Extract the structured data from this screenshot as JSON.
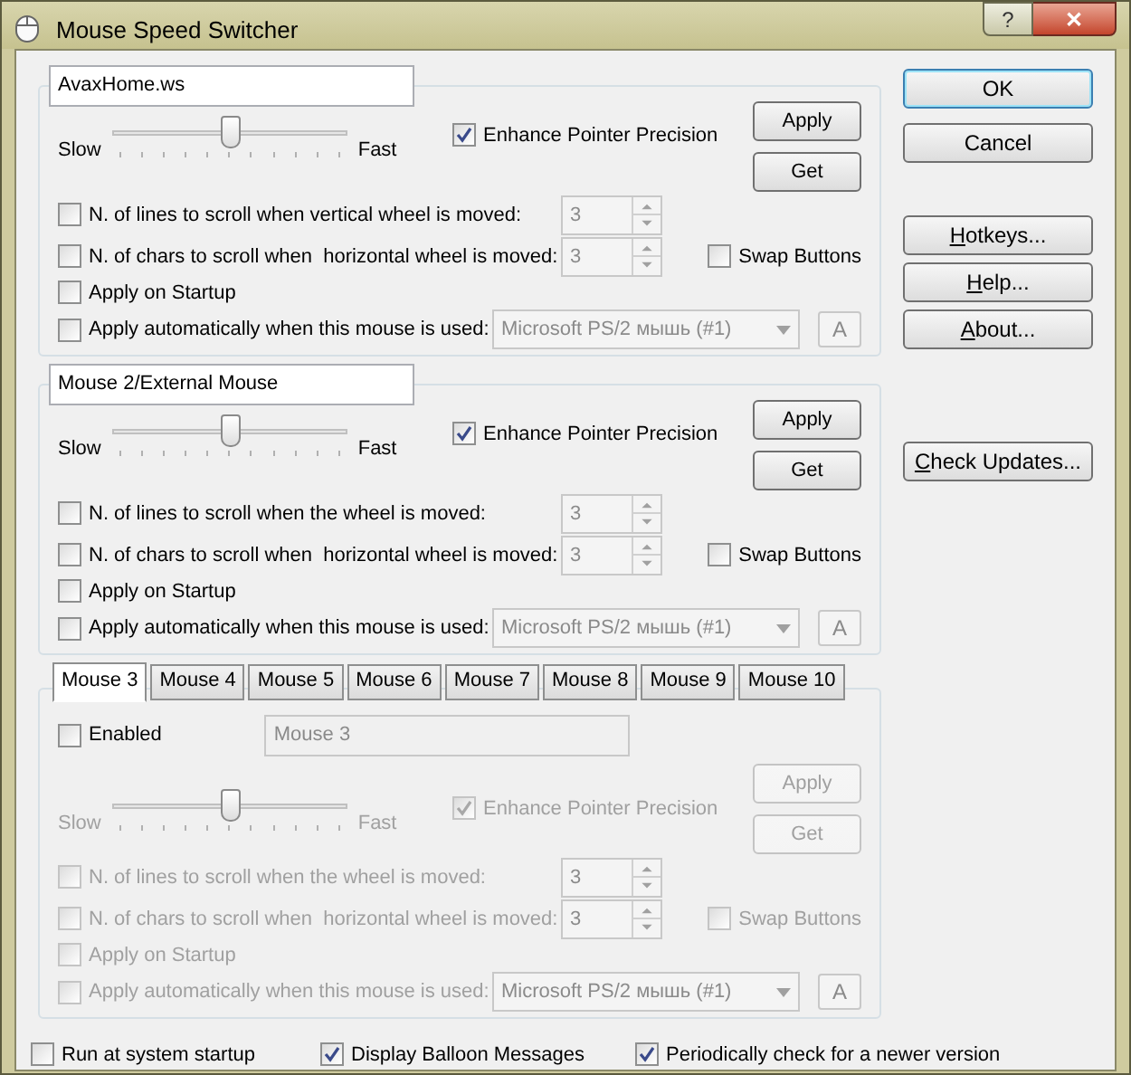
{
  "window": {
    "title": "Mouse Speed Switcher",
    "help": "?",
    "close": "✕"
  },
  "profiles": [
    {
      "kind": "named",
      "disabled": false,
      "name": "AvaxHome.ws",
      "level": 0.5,
      "slow": "Slow",
      "fast": "Fast",
      "enhance": {
        "label": "Enhance Pointer Precision",
        "checked": true
      },
      "apply": "Apply",
      "get": "Get",
      "lines": {
        "label": "N. of lines to scroll when vertical wheel is moved:",
        "checked": false,
        "value": "3"
      },
      "chars": {
        "label": "N. of chars to scroll when  horizontal wheel is moved:",
        "checked": false,
        "value": "3"
      },
      "swap": {
        "label": "Swap Buttons",
        "checked": false
      },
      "startup": {
        "label": "Apply on Startup",
        "checked": false
      },
      "auto": {
        "label": "Apply automatically when this mouse is used:",
        "checked": false,
        "device": "Microsoft PS/2 мышь (#1)",
        "button": "A"
      }
    },
    {
      "kind": "named",
      "disabled": false,
      "name": "Mouse 2/External Mouse",
      "level": 0.5,
      "slow": "Slow",
      "fast": "Fast",
      "enhance": {
        "label": "Enhance Pointer Precision",
        "checked": true
      },
      "apply": "Apply",
      "get": "Get",
      "lines": {
        "label": "N. of lines to scroll when the wheel is moved:",
        "checked": false,
        "value": "3"
      },
      "chars": {
        "label": "N. of chars to scroll when  horizontal wheel is moved:",
        "checked": false,
        "value": "3"
      },
      "swap": {
        "label": "Swap Buttons",
        "checked": false
      },
      "startup": {
        "label": "Apply on Startup",
        "checked": false
      },
      "auto": {
        "label": "Apply automatically when this mouse is used:",
        "checked": false,
        "device": "Microsoft PS/2 мышь (#1)",
        "button": "A"
      }
    },
    {
      "kind": "tabbed",
      "disabled": true,
      "tabs": [
        {
          "label": "Mouse 3",
          "selected": true
        },
        {
          "label": "Mouse 4",
          "selected": false
        },
        {
          "label": "Mouse 5",
          "selected": false
        },
        {
          "label": "Mouse 6",
          "selected": false
        },
        {
          "label": "Mouse 7",
          "selected": false
        },
        {
          "label": "Mouse 8",
          "selected": false
        },
        {
          "label": "Mouse 9",
          "selected": false
        },
        {
          "label": "Mouse 10",
          "selected": false
        }
      ],
      "enabled": {
        "label": "Enabled",
        "checked": false
      },
      "name": "Mouse 3",
      "level": 0.5,
      "slow": "Slow",
      "fast": "Fast",
      "enhance": {
        "label": "Enhance Pointer Precision",
        "checked": true
      },
      "apply": "Apply",
      "get": "Get",
      "lines": {
        "label": "N. of lines to scroll when the wheel is moved:",
        "checked": false,
        "value": "3"
      },
      "chars": {
        "label": "N. of chars to scroll when  horizontal wheel is moved:",
        "checked": false,
        "value": "3"
      },
      "swap": {
        "label": "Swap Buttons",
        "checked": false
      },
      "startup": {
        "label": "Apply on Startup",
        "checked": false
      },
      "auto": {
        "label": "Apply automatically when this mouse is used:",
        "checked": false,
        "device": "Microsoft PS/2 мышь (#1)",
        "button": "A"
      }
    }
  ],
  "side_buttons": [
    {
      "after": "OK",
      "default": true
    },
    {
      "after": "Cancel",
      "default": false
    },
    {
      "key": "H",
      "after": "otkeys...",
      "default": false
    },
    {
      "key": "H",
      "after": "elp...",
      "default": false
    },
    {
      "key": "A",
      "after": "bout...",
      "default": false
    },
    {
      "key": "C",
      "after": "heck Updates...",
      "default": false
    }
  ],
  "footer": [
    {
      "label": "Run at system startup",
      "checked": false
    },
    {
      "label": "Display Balloon Messages",
      "checked": true
    },
    {
      "label": "Periodically check for a newer version",
      "checked": true
    }
  ]
}
